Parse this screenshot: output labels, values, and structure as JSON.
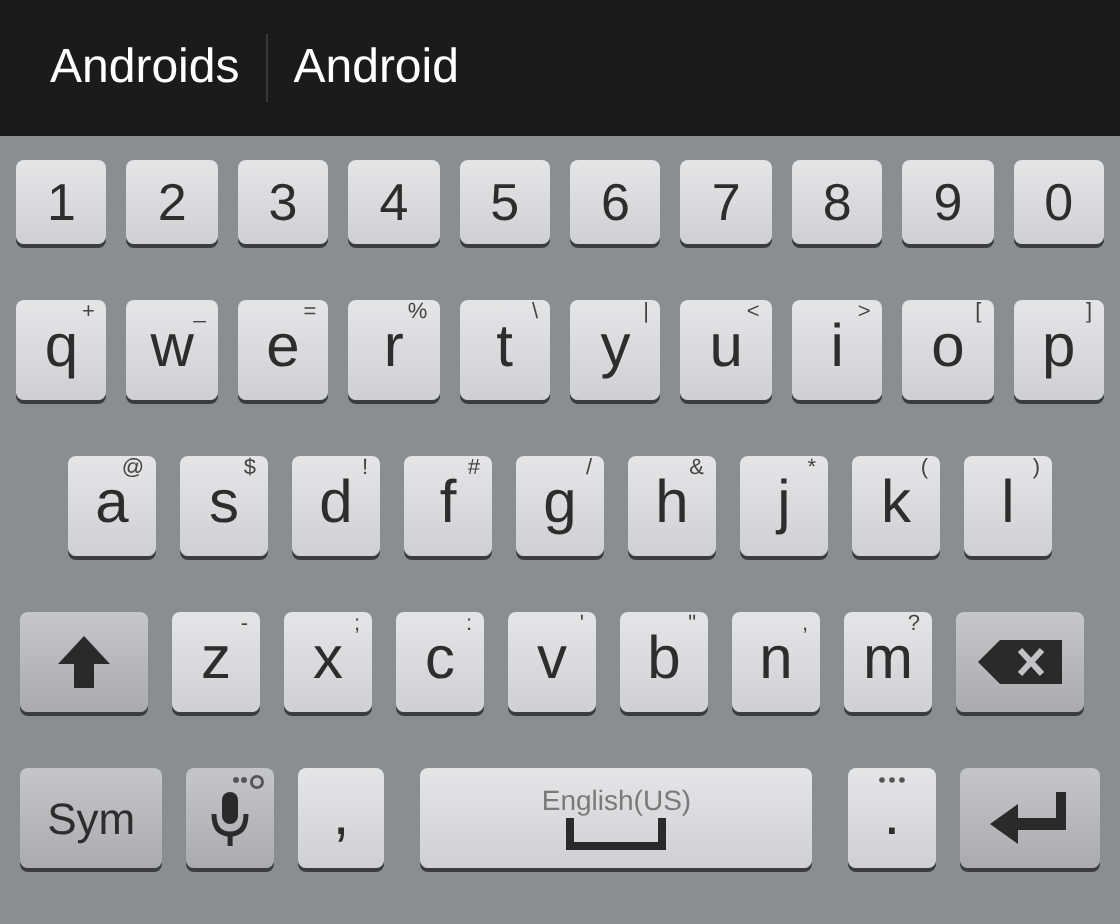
{
  "suggestions": [
    "Androids",
    "Android"
  ],
  "rows": [
    [
      {
        "kind": "char",
        "label": "1"
      },
      {
        "kind": "char",
        "label": "2"
      },
      {
        "kind": "char",
        "label": "3"
      },
      {
        "kind": "char",
        "label": "4"
      },
      {
        "kind": "char",
        "label": "5"
      },
      {
        "kind": "char",
        "label": "6"
      },
      {
        "kind": "char",
        "label": "7"
      },
      {
        "kind": "char",
        "label": "8"
      },
      {
        "kind": "char",
        "label": "9"
      },
      {
        "kind": "char",
        "label": "0"
      }
    ],
    [
      {
        "kind": "char",
        "label": "q",
        "hint": "+"
      },
      {
        "kind": "char",
        "label": "w",
        "hint": "_"
      },
      {
        "kind": "char",
        "label": "e",
        "hint": "="
      },
      {
        "kind": "char",
        "label": "r",
        "hint": "%"
      },
      {
        "kind": "char",
        "label": "t",
        "hint": "\\"
      },
      {
        "kind": "char",
        "label": "y",
        "hint": "|"
      },
      {
        "kind": "char",
        "label": "u",
        "hint": "<"
      },
      {
        "kind": "char",
        "label": "i",
        "hint": ">"
      },
      {
        "kind": "char",
        "label": "o",
        "hint": "["
      },
      {
        "kind": "char",
        "label": "p",
        "hint": "]"
      }
    ],
    [
      {
        "kind": "char",
        "label": "a",
        "hint": "@"
      },
      {
        "kind": "char",
        "label": "s",
        "hint": "$"
      },
      {
        "kind": "char",
        "label": "d",
        "hint": "!"
      },
      {
        "kind": "char",
        "label": "f",
        "hint": "#"
      },
      {
        "kind": "char",
        "label": "g",
        "hint": "/"
      },
      {
        "kind": "char",
        "label": "h",
        "hint": "&"
      },
      {
        "kind": "char",
        "label": "j",
        "hint": "*"
      },
      {
        "kind": "char",
        "label": "k",
        "hint": "("
      },
      {
        "kind": "char",
        "label": "l",
        "hint": ")"
      }
    ],
    [
      {
        "kind": "shift"
      },
      {
        "kind": "char",
        "label": "z",
        "hint": "-"
      },
      {
        "kind": "char",
        "label": "x",
        "hint": ";"
      },
      {
        "kind": "char",
        "label": "c",
        "hint": ":"
      },
      {
        "kind": "char",
        "label": "v",
        "hint": "'"
      },
      {
        "kind": "char",
        "label": "b",
        "hint": "\""
      },
      {
        "kind": "char",
        "label": "n",
        "hint": ","
      },
      {
        "kind": "char",
        "label": "m",
        "hint": "?"
      },
      {
        "kind": "backspace"
      }
    ],
    [
      {
        "kind": "sym",
        "label": "Sym"
      },
      {
        "kind": "mic"
      },
      {
        "kind": "char",
        "label": ","
      },
      {
        "kind": "space",
        "label": "English(US)"
      },
      {
        "kind": "period",
        "label": "."
      },
      {
        "kind": "enter"
      }
    ]
  ]
}
